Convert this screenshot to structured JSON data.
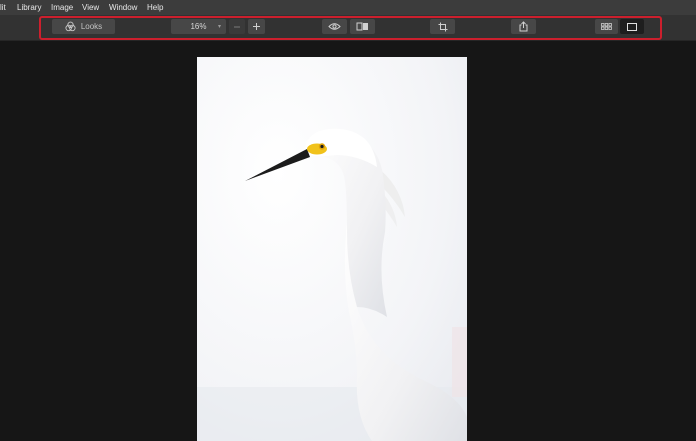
{
  "menu": {
    "items": [
      "lit",
      "Library",
      "Image",
      "View",
      "Window",
      "Help"
    ]
  },
  "toolbar": {
    "looks_label": "Looks",
    "zoom_value": "16%",
    "zoom_caret": "▾",
    "zoom_out_icon": "minus-icon",
    "zoom_in_icon": "plus-icon",
    "preview_icon": "eye-icon",
    "compare_icon": "split-compare-icon",
    "crop_icon": "crop-icon",
    "share_icon": "share-icon",
    "grid_view_icon": "grid-icon",
    "single_view_icon": "single-view-icon"
  },
  "colors": {
    "menubar_bg": "#3c3c3c",
    "toolbar_bg": "#323232",
    "button_bg": "#474747",
    "canvas_bg": "#161616",
    "highlight": "#cc1f2d",
    "beak_yellow": "#f1c21b"
  },
  "photo": {
    "subject": "snowy egret on white background"
  }
}
